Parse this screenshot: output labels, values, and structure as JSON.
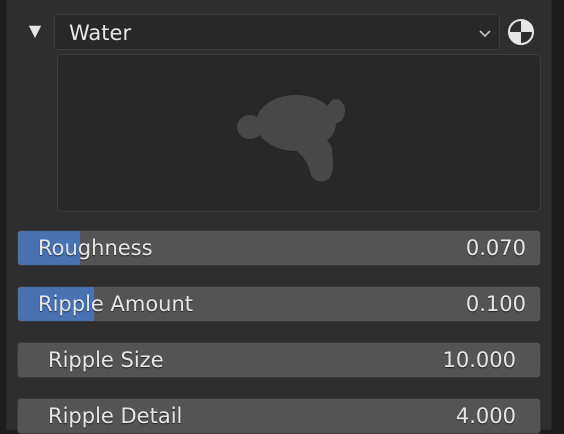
{
  "material": {
    "name": "Water",
    "icons": {
      "collapse": "triangle-down-icon",
      "chevron": "chevron-down-icon",
      "preview": "material-preview-sphere-icon"
    }
  },
  "preview": {
    "shape": "monkey-head-silhouette"
  },
  "properties": [
    {
      "label": "Roughness",
      "value": "0.070",
      "fill_fraction": 0.07,
      "kind": "factor"
    },
    {
      "label": "Ripple Amount",
      "value": "0.100",
      "fill_fraction": 0.1,
      "kind": "factor"
    },
    {
      "label": "Ripple Size",
      "value": "10.000",
      "kind": "number"
    },
    {
      "label": "Ripple Detail",
      "value": "4.000",
      "kind": "number"
    }
  ],
  "colors": {
    "accent": "#4772b3",
    "panel": "#2e2e2e",
    "field": "#545454",
    "text": "#e6e6e6"
  }
}
